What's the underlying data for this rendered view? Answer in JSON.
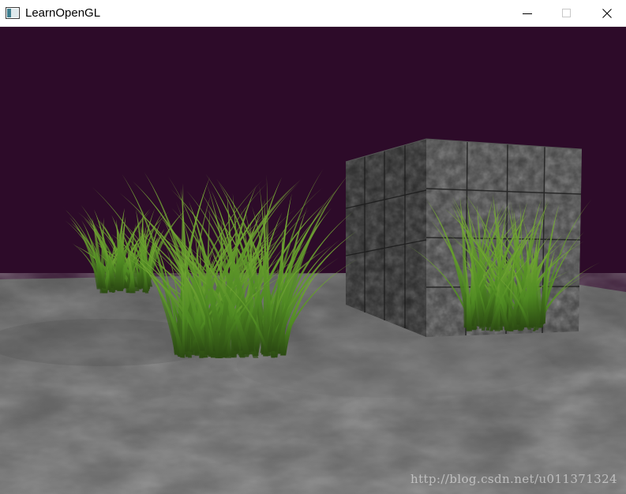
{
  "window": {
    "title": "LearnOpenGL",
    "app_icon": "opengl-window-icon",
    "controls": {
      "minimize_icon": "minimize-icon",
      "maximize_icon": "maximize-icon",
      "close_icon": "close-icon"
    }
  },
  "scene": {
    "clear_color": "#2d0b29",
    "floor_color": "#626262",
    "cube_color": "#3f3f3f",
    "grass_color": "#4f8a22"
  },
  "watermark": {
    "text": "http://blog.csdn.net/u011371324"
  }
}
